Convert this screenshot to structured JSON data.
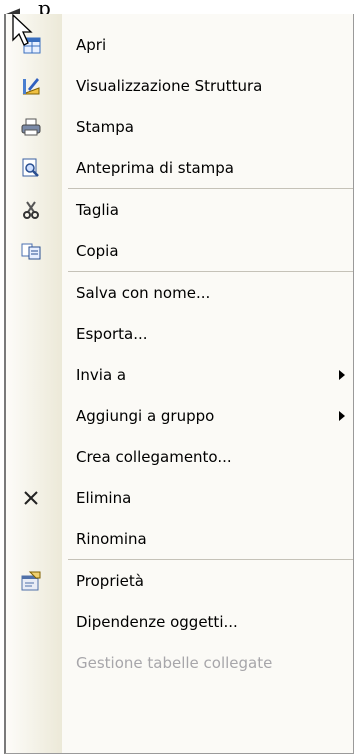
{
  "header": {
    "partial_text": "p"
  },
  "menu": {
    "items": [
      {
        "label": "Apri",
        "icon": "open-table-icon",
        "disabled": false,
        "submenu": false
      },
      {
        "label": "Visualizzazione Struttura",
        "icon": "design-view-icon",
        "disabled": false,
        "submenu": false
      },
      {
        "label": "Stampa",
        "icon": "printer-icon",
        "disabled": false,
        "submenu": false
      },
      {
        "label": "Anteprima di stampa",
        "icon": "print-preview-icon",
        "disabled": false,
        "submenu": false
      },
      {
        "label": "Taglia",
        "icon": "scissors-icon",
        "disabled": false,
        "submenu": false
      },
      {
        "label": "Copia",
        "icon": "copy-icon",
        "disabled": false,
        "submenu": false
      },
      {
        "label": "Salva con nome...",
        "icon": "",
        "disabled": false,
        "submenu": false
      },
      {
        "label": "Esporta...",
        "icon": "",
        "disabled": false,
        "submenu": false
      },
      {
        "label": "Invia a",
        "icon": "",
        "disabled": false,
        "submenu": true
      },
      {
        "label": "Aggiungi a gruppo",
        "icon": "",
        "disabled": false,
        "submenu": true
      },
      {
        "label": "Crea collegamento...",
        "icon": "",
        "disabled": false,
        "submenu": false
      },
      {
        "label": "Elimina",
        "icon": "delete-x-icon",
        "disabled": false,
        "submenu": false
      },
      {
        "label": "Rinomina",
        "icon": "",
        "disabled": false,
        "submenu": false
      },
      {
        "label": "Proprietà",
        "icon": "properties-icon",
        "disabled": false,
        "submenu": false
      },
      {
        "label": "Dipendenze oggetti...",
        "icon": "",
        "disabled": false,
        "submenu": false
      },
      {
        "label": "Gestione tabelle collegate",
        "icon": "",
        "disabled": true,
        "submenu": false
      }
    ]
  },
  "colors": {
    "menu_bg": "#fbfaf6",
    "disabled_text": "#a7a6aa",
    "separator": "#c5c2b8"
  }
}
